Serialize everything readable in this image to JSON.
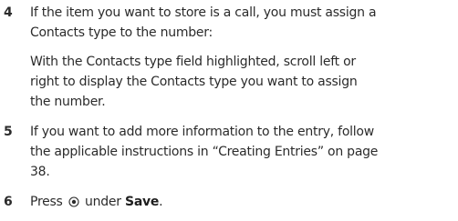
{
  "steps": [
    {
      "number": "4",
      "lines": [
        "If the item you want to store is a call, you must assign a",
        "Contacts type to the number:"
      ],
      "sub_lines": [
        "With the Contacts type field highlighted, scroll left or",
        "right to display the Contacts type you want to assign",
        "the number."
      ]
    },
    {
      "number": "5",
      "lines": [
        "If you want to add more information to the entry, follow",
        "the applicable instructions in “Creating Entries” on page",
        "38."
      ]
    },
    {
      "number": "6",
      "prefix": "Press",
      "icon": "select-key-icon",
      "middle": "under",
      "bold": "Save",
      "suffix": "."
    }
  ]
}
